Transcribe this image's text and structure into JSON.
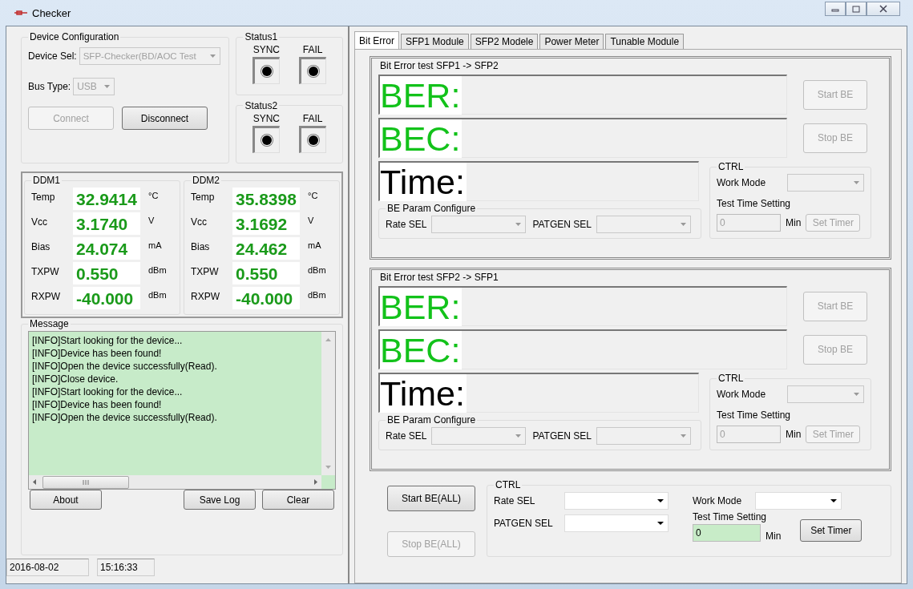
{
  "window": {
    "title": "Checker"
  },
  "device_config": {
    "title": "Device Configuration",
    "device_sel": {
      "label": "Device Sel:",
      "value": "SFP-Checker(BD/AOC Test",
      "disabled": true
    },
    "bus_type": {
      "label": "Bus Type:",
      "value": "USB",
      "disabled": true
    },
    "buttons": [
      {
        "label": "Connect",
        "disabled": true
      },
      {
        "label": "Disconnect",
        "disabled": false
      }
    ]
  },
  "status_groups": [
    {
      "title": "Status1",
      "indicators": [
        {
          "label": "SYNC"
        },
        {
          "label": "FAIL"
        }
      ]
    },
    {
      "title": "Status2",
      "indicators": [
        {
          "label": "SYNC"
        },
        {
          "label": "FAIL"
        }
      ]
    }
  ],
  "ddm": [
    {
      "title": "DDM1",
      "rows": [
        {
          "label": "Temp",
          "value": "32.9414",
          "unit": "°C"
        },
        {
          "label": "Vcc",
          "value": "3.1740",
          "unit": "V"
        },
        {
          "label": "Bias",
          "value": "24.074",
          "unit": "mA"
        },
        {
          "label": "TXPW",
          "value": "0.550",
          "unit": "dBm"
        },
        {
          "label": "RXPW",
          "value": "-40.000",
          "unit": "dBm"
        }
      ]
    },
    {
      "title": "DDM2",
      "rows": [
        {
          "label": "Temp",
          "value": "35.8398",
          "unit": "°C"
        },
        {
          "label": "Vcc",
          "value": "3.1692",
          "unit": "V"
        },
        {
          "label": "Bias",
          "value": "24.462",
          "unit": "mA"
        },
        {
          "label": "TXPW",
          "value": "0.550",
          "unit": "dBm"
        },
        {
          "label": "RXPW",
          "value": "-40.000",
          "unit": "dBm"
        }
      ]
    }
  ],
  "message": {
    "title": "Message",
    "lines": [
      "[INFO]Start looking for the device...",
      "[INFO]Device has been found!",
      "[INFO]Open the device successfully(Read).",
      "[INFO]Close device.",
      "[INFO]Start looking for the device...",
      "[INFO]Device has been found!",
      "[INFO]Open the device successfully(Read)."
    ]
  },
  "log_buttons": [
    {
      "label": "About"
    },
    {
      "label": "Save Log"
    },
    {
      "label": "Clear"
    }
  ],
  "status_bar": {
    "date": "2016-08-02",
    "time": "15:16:33"
  },
  "tabs": [
    {
      "label": "Bit Error",
      "selected": true
    },
    {
      "label": "SFP1 Module",
      "selected": false
    },
    {
      "label": "SFP2 Modele",
      "selected": false
    },
    {
      "label": "Power Meter",
      "selected": false
    },
    {
      "label": "Tunable Module",
      "selected": false
    }
  ],
  "bit_error_tests": [
    {
      "title": "Bit Error test SFP1 -> SFP2",
      "ber_label": "BER:",
      "bec_label": "BEC:",
      "time_label": "Time:",
      "buttons": [
        {
          "label": "Start BE",
          "disabled": true
        },
        {
          "label": "Stop BE",
          "disabled": true
        }
      ],
      "param": {
        "title": "BE Param Configure",
        "rate_sel_label": "Rate SEL",
        "patgen_sel_label": "PATGEN SEL",
        "disabled": true
      },
      "ctrl": {
        "title": "CTRL",
        "work_mode_label": "Work Mode",
        "test_time_label": "Test Time Setting",
        "timer_value": "0",
        "min_label": "Min",
        "disabled": true,
        "set_timer": {
          "label": "Set Timer",
          "disabled": true
        }
      }
    },
    {
      "title": "Bit Error test SFP2 -> SFP1",
      "ber_label": "BER:",
      "bec_label": "BEC:",
      "time_label": "Time:",
      "buttons": [
        {
          "label": "Start BE",
          "disabled": true
        },
        {
          "label": "Stop BE",
          "disabled": true
        }
      ],
      "param": {
        "title": "BE Param Configure",
        "rate_sel_label": "Rate SEL",
        "patgen_sel_label": "PATGEN SEL",
        "disabled": true
      },
      "ctrl": {
        "title": "CTRL",
        "work_mode_label": "Work Mode",
        "test_time_label": "Test Time Setting",
        "timer_value": "0",
        "min_label": "Min",
        "disabled": true,
        "set_timer": {
          "label": "Set Timer",
          "disabled": true
        }
      }
    }
  ],
  "all_controls": {
    "buttons": [
      {
        "label": "Start BE(ALL)",
        "disabled": false
      },
      {
        "label": "Stop BE(ALL)",
        "disabled": true
      }
    ],
    "ctrl": {
      "title": "CTRL",
      "rate_sel_label": "Rate SEL",
      "patgen_sel_label": "PATGEN SEL",
      "work_mode_label": "Work Mode",
      "test_time_label": "Test Time Setting",
      "timer_value": "0",
      "min_label": "Min",
      "disabled": false,
      "set_timer": {
        "label": "Set Timer",
        "disabled": false
      }
    }
  }
}
